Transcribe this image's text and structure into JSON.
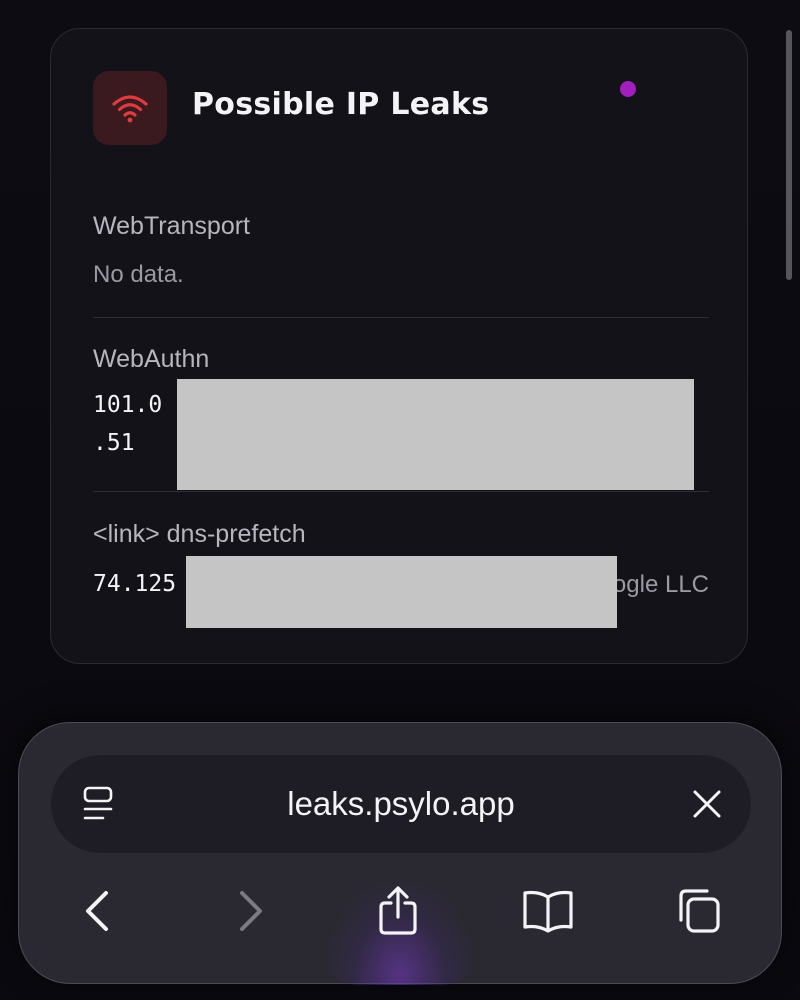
{
  "card": {
    "title": "Possible IP Leaks",
    "accent_color": "#e03a3e",
    "status_dot_color": "#a21fbf",
    "icon": "wifi-icon",
    "sections": {
      "webtransport": {
        "label": "WebTransport",
        "value": "No data."
      },
      "webauthn": {
        "label": "WebAuthn",
        "ip_line1": "101.0",
        "ip_line2": ".51"
      },
      "dns_prefetch": {
        "label": "<link> dns-prefetch",
        "ip": "74.125",
        "org": "ogle LLC"
      }
    }
  },
  "browser": {
    "url": "leaks.psylo.app",
    "icons": {
      "tabs_menu": "reader-menu-icon",
      "close": "close-icon",
      "back": "chevron-left-icon",
      "forward": "chevron-right-icon",
      "share": "share-icon",
      "bookmarks": "book-icon",
      "tabs": "tabs-overview-icon"
    }
  }
}
